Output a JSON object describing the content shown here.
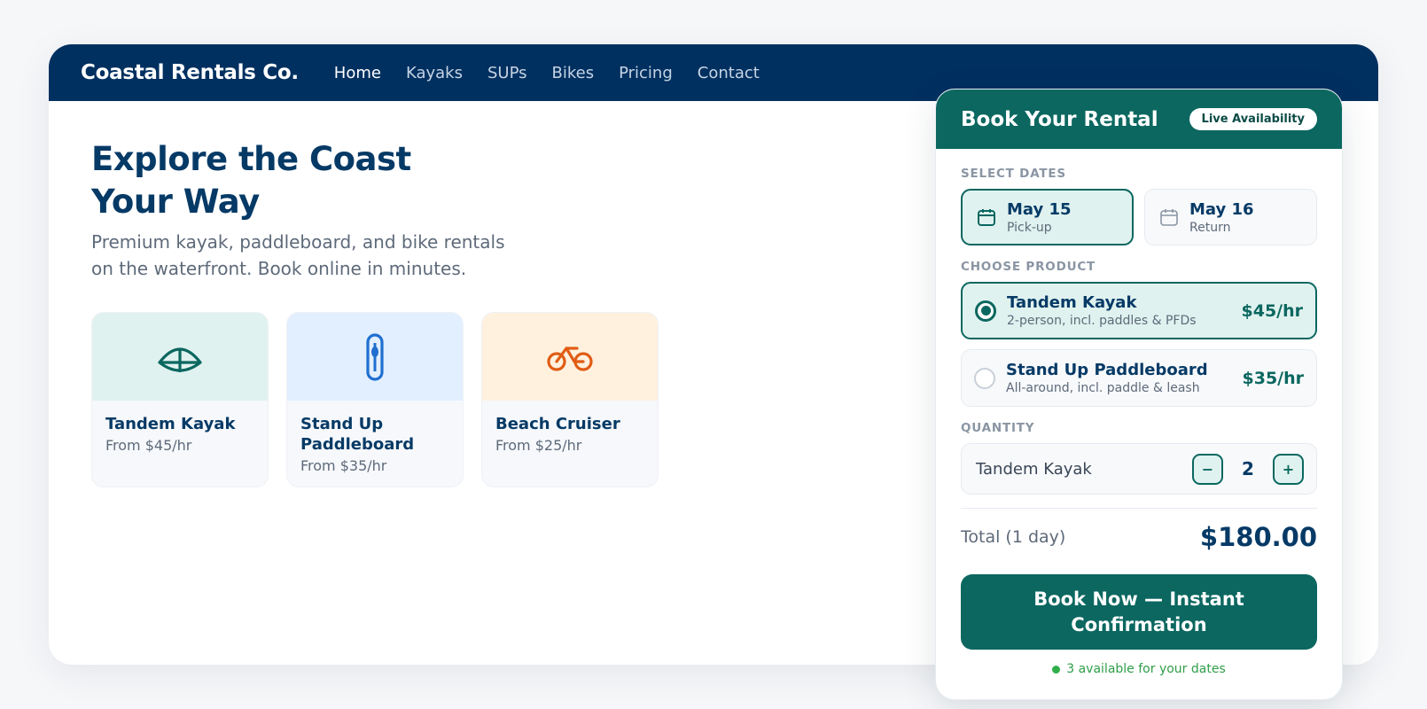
{
  "nav": {
    "brand": "Coastal Rentals Co.",
    "links": [
      "Home",
      "Kayaks",
      "SUPs",
      "Bikes",
      "Pricing",
      "Contact"
    ],
    "active": "Home"
  },
  "hero": {
    "title": "Explore the Coast Your Way",
    "subtitle": "Premium kayak, paddleboard, and bike rentals on the waterfront. Book online in minutes."
  },
  "cards": [
    {
      "name": "Tandem Kayak",
      "price": "From $45/hr",
      "icon": "kayak-icon",
      "bg": "#e0f2ef",
      "icon_color": "#0b6760"
    },
    {
      "name": "Stand Up Paddleboard",
      "price": "From $35/hr",
      "icon": "paddleboard-icon",
      "bg": "#e2efff",
      "icon_color": "#1f6fd0"
    },
    {
      "name": "Beach Cruiser",
      "price": "From $25/hr",
      "icon": "bike-icon",
      "bg": "#fff1de",
      "icon_color": "#e05d14"
    }
  ],
  "booking": {
    "title": "Book Your Rental",
    "badge": "Live Availability",
    "dates_label": "SELECT DATES",
    "pickup": {
      "date": "May 15",
      "label": "Pick-up"
    },
    "return": {
      "date": "May 16",
      "label": "Return"
    },
    "product_label": "CHOOSE PRODUCT",
    "products": [
      {
        "name": "Tandem Kayak",
        "desc": "2-person, incl. paddles & PFDs",
        "price": "$45/hr",
        "selected": true
      },
      {
        "name": "Stand Up Paddleboard",
        "desc": "All-around, incl. paddle & leash",
        "price": "$35/hr",
        "selected": false
      }
    ],
    "quantity_label": "QUANTITY",
    "quantity": {
      "item": "Tandem Kayak",
      "value": "2",
      "minus": "−",
      "plus": "+"
    },
    "total_label": "Total (1 day)",
    "total_value": "$180.00",
    "cta": "Book Now — Instant Confirmation",
    "availability": "3 available for your dates"
  },
  "colors": {
    "brand": "#003060",
    "accent": "#0b6760",
    "available": "#2fae4a"
  }
}
